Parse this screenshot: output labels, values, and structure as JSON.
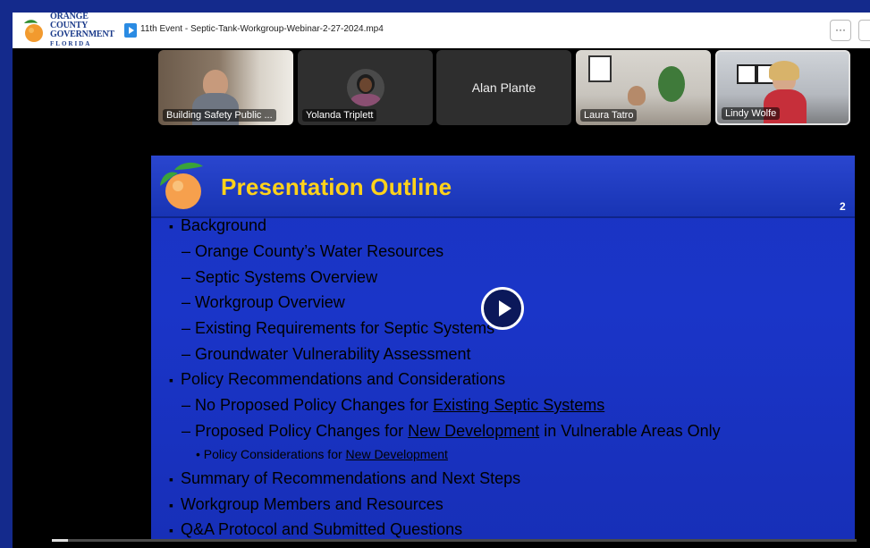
{
  "header": {
    "logo": {
      "line1": "ORANGE COUNTY",
      "line2": "GOVERNMENT",
      "line3": "FLORIDA"
    },
    "file_icon": "video-file-icon",
    "file_title": "11th Event - Septic-Tank-Workgroup-Webinar-2-27-2024.mp4",
    "more_label": "···"
  },
  "participants": [
    {
      "name": "Building Safety Public ...",
      "type": "video"
    },
    {
      "name": "Yolanda Triplett",
      "type": "avatar"
    },
    {
      "name": "Alan Plante",
      "type": "name-only"
    },
    {
      "name": "Laura Tatro",
      "type": "video"
    },
    {
      "name": "Lindy Wolfe",
      "type": "video"
    }
  ],
  "slide": {
    "title": "Presentation Outline",
    "page_number": "2",
    "items": {
      "background": "Background",
      "water": "Orange County’s Water Resources",
      "septic_overview": "Septic Systems Overview",
      "workgroup_overview": "Workgroup Overview",
      "existing_req": "Existing Requirements for Septic Systems",
      "groundwater": "Groundwater Vulnerability Assessment",
      "policy": "Policy Recommendations and Considerations",
      "no_proposed_prefix": "No Proposed Policy Changes for ",
      "no_proposed_link": "Existing Septic Systems",
      "proposed_prefix": "Proposed Policy Changes for ",
      "proposed_link": "New Development",
      "proposed_suffix": " in Vulnerable Areas Only",
      "considerations_prefix": "Policy Considerations for ",
      "considerations_link": "New Development",
      "summary": "Summary of Recommendations and Next Steps",
      "members": "Workgroup Members and Resources",
      "qa": "Q&A Protocol and Submitted Questions"
    }
  },
  "player": {
    "play_icon": "play-icon",
    "progress": 0.02
  },
  "colors": {
    "slide_bg": "#1a35c8",
    "title_yellow": "#ffd21a",
    "frame": "#142a8c"
  }
}
